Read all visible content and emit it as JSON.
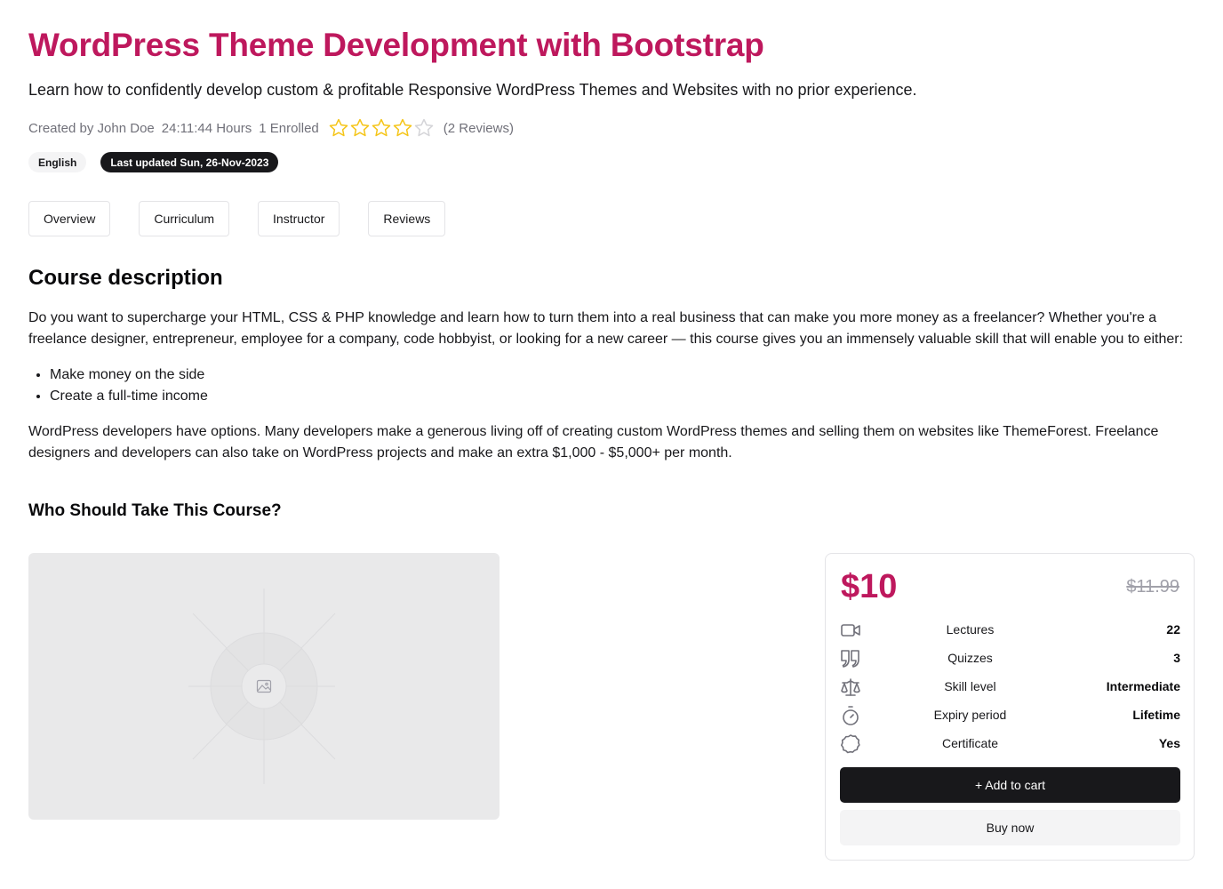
{
  "course": {
    "title": "WordPress Theme Development with Bootstrap",
    "subtitle": "Learn how to confidently develop custom & profitable Responsive WordPress Themes and Websites with no prior experience."
  },
  "meta": {
    "created_by": "Created by John Doe",
    "duration": "24:11:44 Hours",
    "enrolled": "1 Enrolled",
    "rating_value": 4,
    "rating_max": 5,
    "reviews": "(2 Reviews)"
  },
  "badges": {
    "language": "English",
    "updated": "Last updated Sun, 26-Nov-2023"
  },
  "tabs": [
    {
      "label": "Overview"
    },
    {
      "label": "Curriculum"
    },
    {
      "label": "Instructor"
    },
    {
      "label": "Reviews"
    }
  ],
  "description": {
    "heading": "Course description",
    "paragraph1": "Do you want to supercharge your HTML, CSS & PHP knowledge and learn how to turn them into a real business that can make you more money as a freelancer? Whether you're a freelance designer, entrepreneur, employee for a company, code hobbyist, or looking for a new career — this course gives you an immensely valuable skill that will enable you to either:",
    "bullets": [
      "Make money on the side",
      "Create a full-time income"
    ],
    "paragraph2": "WordPress developers have options. Many developers make a generous living off of creating custom WordPress themes and selling them on websites like ThemeForest. Freelance designers and developers can also take on WordPress projects and make an extra $1,000 - $5,000+ per month.",
    "subheading": "Who Should Take This Course?"
  },
  "pricing": {
    "price": "$10",
    "old_price": "$11.99",
    "stats": [
      {
        "icon": "video-icon",
        "label": "Lectures",
        "value": "22"
      },
      {
        "icon": "quote-icon",
        "label": "Quizzes",
        "value": "3"
      },
      {
        "icon": "scale-icon",
        "label": "Skill level",
        "value": "Intermediate"
      },
      {
        "icon": "timer-icon",
        "label": "Expiry period",
        "value": "Lifetime"
      },
      {
        "icon": "badge-icon",
        "label": "Certificate",
        "value": "Yes"
      }
    ],
    "add_to_cart": "+ Add to cart",
    "buy_now": "Buy now"
  },
  "colors": {
    "accent": "#be185d",
    "star": "#f5c518",
    "star_empty": "#d4d4d8",
    "dark": "#18181b"
  }
}
